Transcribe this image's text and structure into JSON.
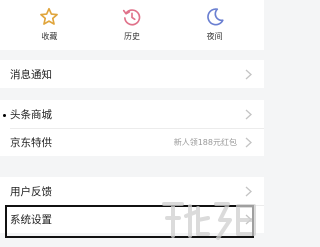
{
  "quick": {
    "favorites": {
      "label": "收藏",
      "icon": "star-icon"
    },
    "history": {
      "label": "历史",
      "icon": "history-icon"
    },
    "night": {
      "label": "夜间",
      "icon": "moon-icon"
    }
  },
  "menu": {
    "notifications": {
      "label": "消息通知"
    },
    "mall": {
      "label": "头条商城"
    },
    "jd": {
      "label": "京东特供",
      "subtitle": "新人领188元红包"
    },
    "feedback": {
      "label": "用户反馈"
    },
    "settings": {
      "label": "系统设置"
    }
  },
  "watermark": {
    "icon": "site-watermark-logo"
  },
  "colors": {
    "star": "#e0a53c",
    "history": "#e0728a",
    "moon": "#6a7fd1",
    "chevron": "#c4c4c4"
  }
}
